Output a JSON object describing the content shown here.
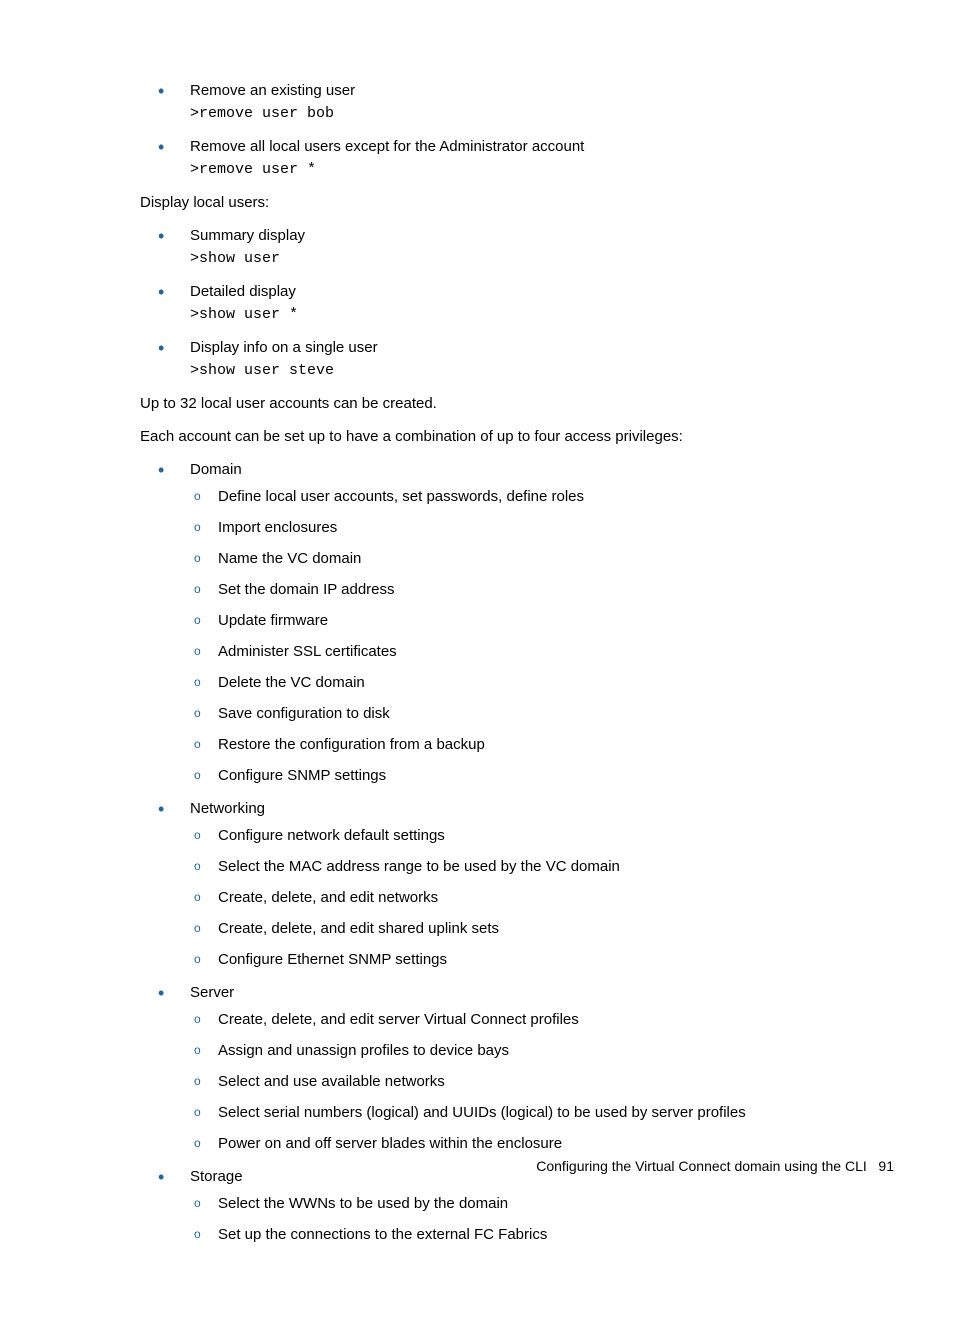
{
  "topList": [
    {
      "text": "Remove an existing user",
      "cmd": ">remove user bob"
    },
    {
      "text": "Remove all local users except for the Administrator account",
      "cmd": ">remove user *"
    }
  ],
  "paras": {
    "displayLocal": "Display local users:",
    "upTo32": "Up to 32 local user accounts can be created.",
    "eachAccount": "Each account can be set up to have a combination of up to four access privileges:"
  },
  "displayList": [
    {
      "text": "Summary display",
      "cmd": ">show user"
    },
    {
      "text": "Detailed display",
      "cmd": ">show user *"
    },
    {
      "text": "Display info on a single user",
      "cmd": ">show user steve"
    }
  ],
  "privileges": [
    {
      "name": "Domain",
      "items": [
        "Define local user accounts, set passwords, define roles",
        "Import enclosures",
        "Name the VC domain",
        "Set the domain IP address",
        "Update firmware",
        "Administer SSL certificates",
        "Delete the VC domain",
        "Save configuration to disk",
        "Restore the configuration from a backup",
        "Configure SNMP settings"
      ]
    },
    {
      "name": "Networking",
      "items": [
        "Configure network default settings",
        "Select the MAC address range to be used by the VC domain",
        "Create, delete, and edit networks",
        "Create, delete, and edit shared uplink sets",
        "Configure Ethernet SNMP settings"
      ]
    },
    {
      "name": "Server",
      "items": [
        "Create, delete, and edit server Virtual Connect profiles",
        "Assign and unassign profiles to device bays",
        "Select and use available networks",
        "Select serial numbers (logical) and UUIDs (logical) to be used by server profiles",
        "Power on and off server blades within the enclosure"
      ]
    },
    {
      "name": "Storage",
      "items": [
        "Select the WWNs to be used by the domain",
        "Set up the connections to the external FC Fabrics"
      ]
    }
  ],
  "footer": {
    "text": "Configuring the Virtual Connect domain using the CLI",
    "page": "91"
  }
}
